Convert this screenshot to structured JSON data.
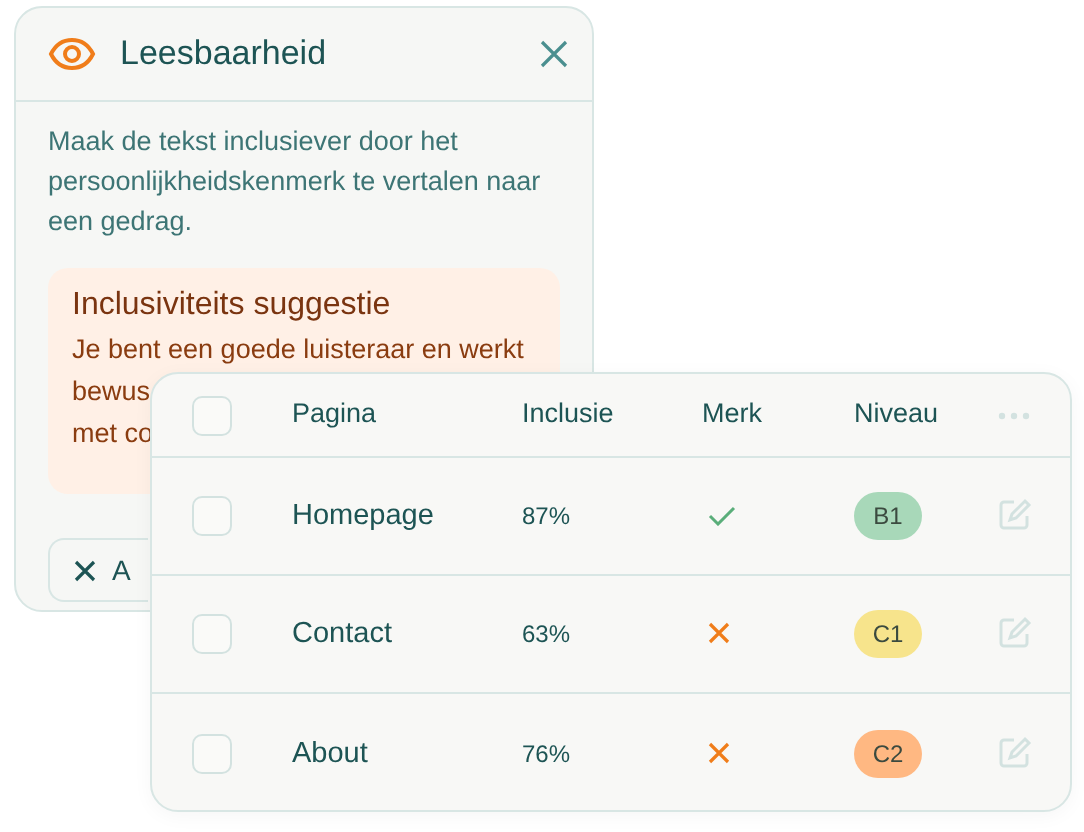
{
  "panel": {
    "title": "Leesbaarheid",
    "description": "Maak de tekst inclusiever door het persoonlijkheidskenmerk te vertalen naar een gedrag.",
    "suggestion": {
      "title": "Inclusiviteits suggestie",
      "lines": [
        "Je bent een goede luisteraar en werkt",
        "bewus",
        "met co"
      ]
    },
    "button": {
      "label": "A"
    }
  },
  "table": {
    "columns": [
      "Pagina",
      "Inclusie",
      "Merk",
      "Niveau"
    ],
    "header_checked": false,
    "rows": [
      {
        "page": "Homepage",
        "inclusion": "87%",
        "mark": true,
        "level": "B1",
        "color": "#a8d8b9",
        "checked": false
      },
      {
        "page": "Contact",
        "inclusion": "63%",
        "mark": false,
        "level": "C1",
        "color": "#f7e48c",
        "checked": false
      },
      {
        "page": "About",
        "inclusion": "76%",
        "mark": false,
        "level": "C2",
        "color": "#ffb882",
        "checked": false
      }
    ]
  }
}
